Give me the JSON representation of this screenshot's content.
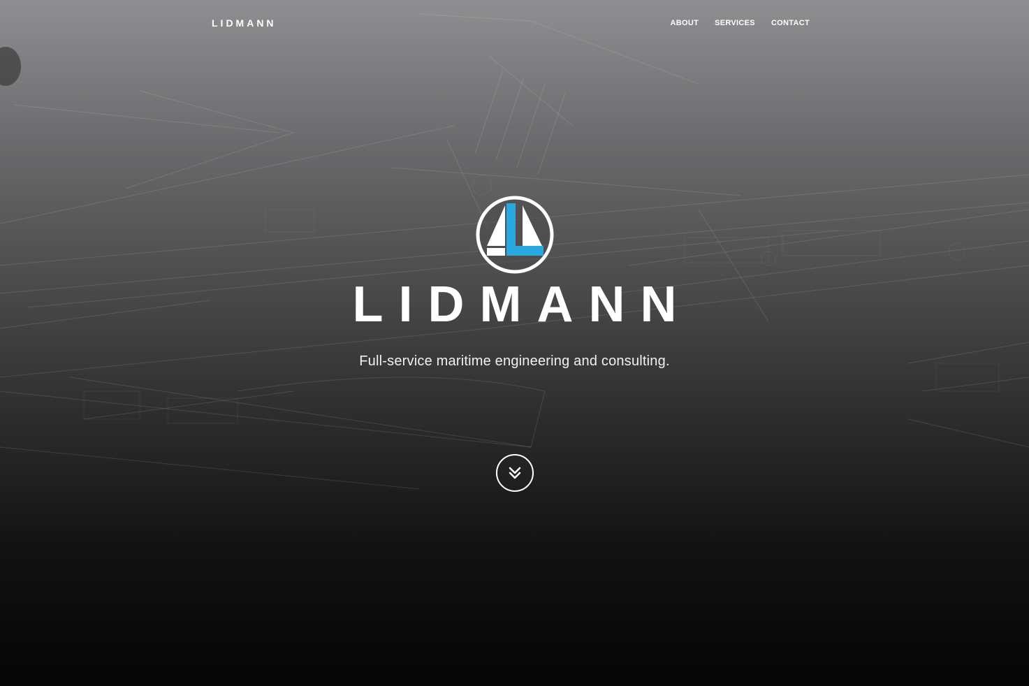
{
  "nav": {
    "brand": "LIDMANN",
    "links": [
      {
        "label": "ABOUT"
      },
      {
        "label": "SERVICES"
      },
      {
        "label": "CONTACT"
      }
    ]
  },
  "hero": {
    "logo_icon": "sailboat-l-logo-icon",
    "title": "LIDMANN",
    "subtitle": "Full-service maritime engineering and consulting.",
    "scroll_icon": "double-chevron-down-icon"
  },
  "colors": {
    "accent": "#29a8e0",
    "text": "#ffffff"
  }
}
